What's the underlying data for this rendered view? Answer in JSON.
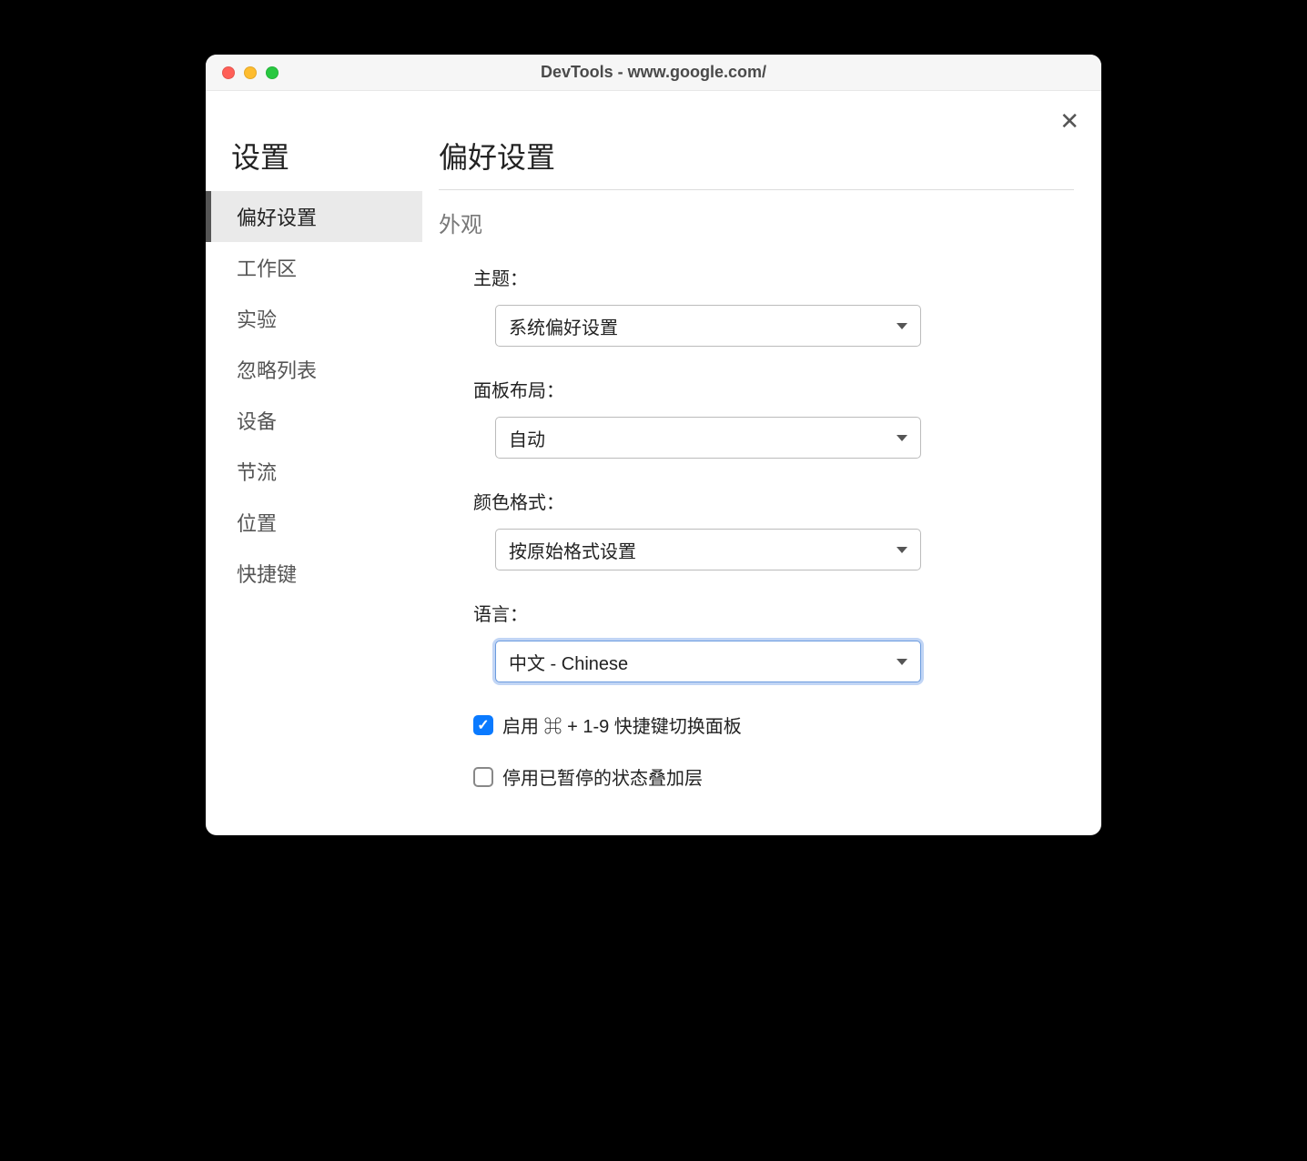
{
  "window": {
    "title": "DevTools - www.google.com/"
  },
  "sidebar": {
    "title": "设置",
    "items": [
      {
        "label": "偏好设置",
        "active": true
      },
      {
        "label": "工作区",
        "active": false
      },
      {
        "label": "实验",
        "active": false
      },
      {
        "label": "忽略列表",
        "active": false
      },
      {
        "label": "设备",
        "active": false
      },
      {
        "label": "节流",
        "active": false
      },
      {
        "label": "位置",
        "active": false
      },
      {
        "label": "快捷键",
        "active": false
      }
    ]
  },
  "main": {
    "title": "偏好设置",
    "section_title": "外观",
    "fields": {
      "theme": {
        "label": "主题：",
        "value": "系统偏好设置"
      },
      "panel_layout": {
        "label": "面板布局：",
        "value": "自动"
      },
      "color_format": {
        "label": "颜色格式：",
        "value": "按原始格式设置"
      },
      "language": {
        "label": "语言：",
        "value": "中文 - Chinese",
        "focused": true
      }
    },
    "checkboxes": {
      "shortcut_panels": {
        "checked": true,
        "label": "启用 ⌘ + 1-9 快捷键切换面板"
      },
      "paused_overlay": {
        "checked": false,
        "label": "停用已暂停的状态叠加层"
      }
    }
  }
}
